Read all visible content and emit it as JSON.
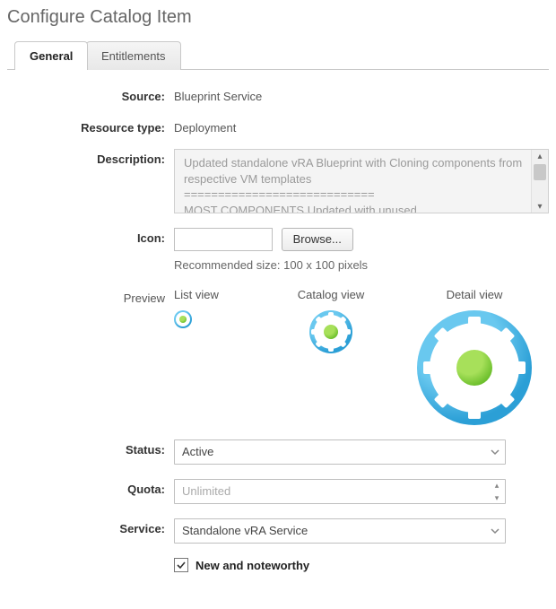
{
  "title": "Configure Catalog Item",
  "tabs": {
    "general": "General",
    "entitlements": "Entitlements"
  },
  "form": {
    "source": {
      "label": "Source:",
      "value": "Blueprint Service"
    },
    "resource_type": {
      "label": "Resource type:",
      "value": "Deployment"
    },
    "description": {
      "label": "Description:",
      "value": "Updated standalone vRA Blueprint with Cloning components from respective VM templates\n============================\nMOST COMPONENTS Updated with unused"
    },
    "icon": {
      "label": "Icon:",
      "browse": "Browse...",
      "hint": "Recommended size: 100 x 100 pixels"
    },
    "preview": {
      "label": "Preview",
      "list_view": "List view",
      "catalog_view": "Catalog view",
      "detail_view": "Detail view"
    },
    "status": {
      "label": "Status:",
      "value": "Active"
    },
    "quota": {
      "label": "Quota:",
      "placeholder": "Unlimited"
    },
    "service": {
      "label": "Service:",
      "value": "Standalone vRA Service"
    },
    "noteworthy": {
      "label": "New and noteworthy",
      "checked": true
    }
  }
}
